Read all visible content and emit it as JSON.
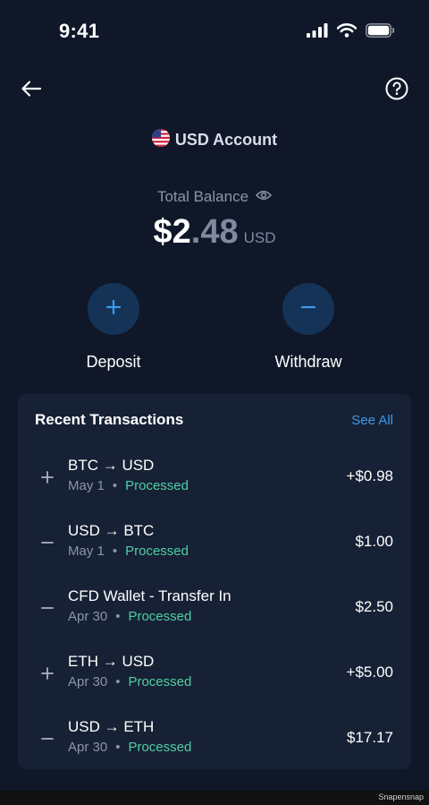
{
  "status_bar": {
    "time": "9:41",
    "icons": [
      "cellular-signal-icon",
      "wifi-icon",
      "battery-icon"
    ]
  },
  "nav": {
    "back_icon": "arrow-left-icon",
    "help_icon": "question-circle-icon"
  },
  "account": {
    "flag_icon": "us-flag-icon",
    "name": "USD Account"
  },
  "balance": {
    "label": "Total Balance",
    "visibility_icon": "eye-icon",
    "integer": "$2",
    "decimal": ".48",
    "currency": "USD"
  },
  "actions": {
    "deposit": {
      "icon": "plus-icon",
      "label": "Deposit"
    },
    "withdraw": {
      "icon": "minus-icon",
      "label": "Withdraw"
    }
  },
  "recent": {
    "title": "Recent Transactions",
    "see_all": "See All",
    "transactions": [
      {
        "icon": "plus-icon",
        "title": "BTC → USD",
        "date": "May 1",
        "status": "Processed",
        "amount": "+$0.98"
      },
      {
        "icon": "minus-icon",
        "title": "USD → BTC",
        "date": "May 1",
        "status": "Processed",
        "amount": "$1.00"
      },
      {
        "icon": "minus-icon",
        "title": "CFD Wallet - Transfer In",
        "date": "Apr 30",
        "status": "Processed",
        "amount": "$2.50"
      },
      {
        "icon": "plus-icon",
        "title": "ETH → USD",
        "date": "Apr 30",
        "status": "Processed",
        "amount": "+$5.00"
      },
      {
        "icon": "minus-icon",
        "title": "USD → ETH",
        "date": "Apr 30",
        "status": "Processed",
        "amount": "$17.17"
      }
    ]
  },
  "colors": {
    "background": "#0f1729",
    "card": "#172135",
    "accent": "#3b9bf0",
    "status_processed": "#4fcfa5",
    "action_circle": "#153356"
  },
  "watermark": "Snapensnap"
}
